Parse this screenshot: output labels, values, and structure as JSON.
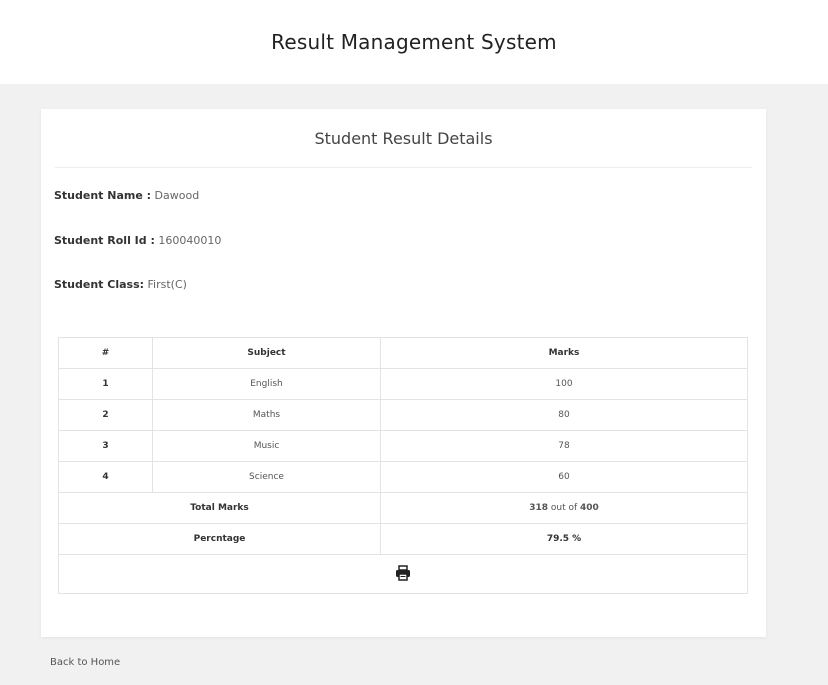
{
  "header": {
    "title": "Result Management System"
  },
  "card": {
    "title": "Student Result Details",
    "student_name_label": "Student Name :",
    "student_name": " Dawood",
    "roll_id_label": "Student Roll Id :",
    "roll_id": " 160040010",
    "class_label": "Student Class:",
    "class_value": " First(C)"
  },
  "table": {
    "headers": [
      "#",
      "Subject",
      "Marks"
    ],
    "rows": [
      {
        "num": "1",
        "subject": "English",
        "marks": "100"
      },
      {
        "num": "2",
        "subject": "Maths",
        "marks": "80"
      },
      {
        "num": "3",
        "subject": "Music",
        "marks": "78"
      },
      {
        "num": "4",
        "subject": "Science",
        "marks": "60"
      }
    ],
    "total_label": "Total Marks",
    "total_obtained": "318",
    "total_mid": " out of ",
    "total_max": "400",
    "percentage_label": "Percntage",
    "percentage_value": "79.5 %",
    "print_icon": "printer-icon"
  },
  "footer": {
    "back_link": "Back to Home"
  }
}
